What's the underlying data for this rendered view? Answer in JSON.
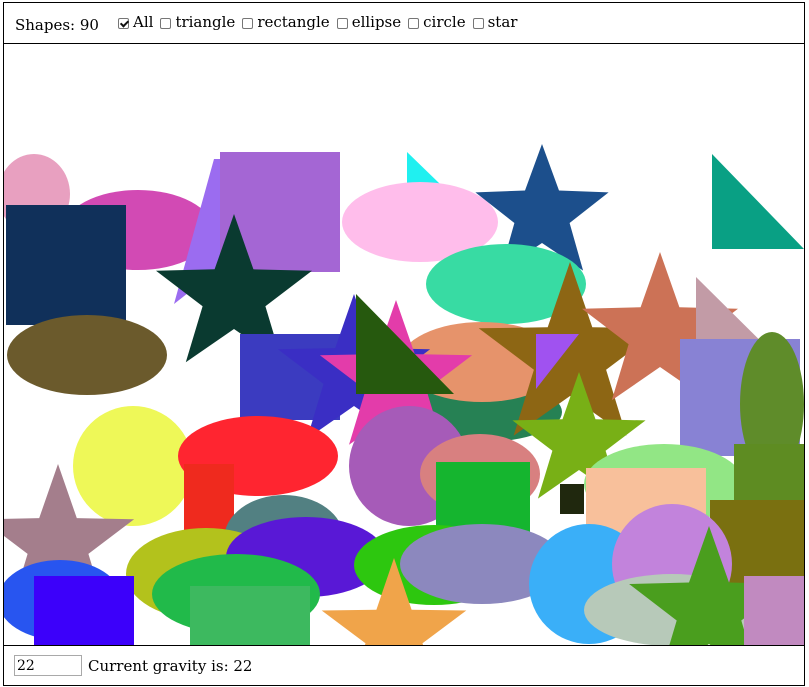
{
  "header": {
    "shape_count_label": "Shapes: 90",
    "filters": [
      {
        "label": "All",
        "checked": true
      },
      {
        "label": "triangle",
        "checked": false
      },
      {
        "label": "rectangle",
        "checked": false
      },
      {
        "label": "ellipse",
        "checked": false
      },
      {
        "label": "circle",
        "checked": false
      },
      {
        "label": "star",
        "checked": false
      }
    ]
  },
  "footer": {
    "gravity_value": "22",
    "gravity_label": "Current gravity is: 22"
  },
  "shapes": [
    {
      "type": "ellipse",
      "color": "#E8A0C0"
    },
    {
      "type": "ellipse",
      "color": "#D24AB4"
    },
    {
      "type": "triangle",
      "color": "#9B6CF0"
    },
    {
      "type": "rectangle",
      "color": "#A466D4"
    },
    {
      "type": "triangle",
      "color": "#20F0F0"
    },
    {
      "type": "ellipse",
      "color": "#FFBDEB"
    },
    {
      "type": "star",
      "color": "#1C4F8C"
    },
    {
      "type": "triangle",
      "color": "#09A084"
    },
    {
      "type": "rectangle",
      "color": "#10305A"
    },
    {
      "type": "star",
      "color": "#0A3A30"
    },
    {
      "type": "ellipse",
      "color": "#6B5A2C"
    },
    {
      "type": "ellipse",
      "color": "#38DBA3"
    },
    {
      "type": "ellipse",
      "color": "#268154"
    },
    {
      "type": "ellipse",
      "color": "#E6936B"
    },
    {
      "type": "rectangle",
      "color": "#3B3BC0"
    },
    {
      "type": "star",
      "color": "#3A2EC4"
    },
    {
      "type": "star",
      "color": "#E33CAA"
    },
    {
      "type": "triangle",
      "color": "#26590E"
    },
    {
      "type": "star",
      "color": "#8D6614"
    },
    {
      "type": "star",
      "color": "#CC7256"
    },
    {
      "type": "triangle",
      "color": "#C29BA6"
    },
    {
      "type": "rectangle",
      "color": "#8882D4"
    },
    {
      "type": "ellipse",
      "color": "#5F8C2A"
    },
    {
      "type": "star",
      "color": "#78B016"
    },
    {
      "type": "triangle",
      "color": "#A052F0"
    },
    {
      "type": "circle",
      "color": "#EEF858"
    },
    {
      "type": "ellipse",
      "color": "#FF2530"
    },
    {
      "type": "circle",
      "color": "#A65BB8"
    },
    {
      "type": "ellipse",
      "color": "#D88080"
    },
    {
      "type": "rectangle",
      "color": "#15B52F"
    },
    {
      "type": "ellipse",
      "color": "#92E685"
    },
    {
      "type": "rectangle",
      "color": "#F8C09B"
    },
    {
      "type": "rectangle",
      "color": "#5E8C22"
    },
    {
      "type": "rectangle",
      "color": "#7A7010"
    },
    {
      "type": "star",
      "color": "#A47E8C"
    },
    {
      "type": "rectangle",
      "color": "#EF2A1E"
    },
    {
      "type": "ellipse",
      "color": "#528082"
    },
    {
      "type": "ellipse",
      "color": "#B3C21C"
    },
    {
      "type": "ellipse",
      "color": "#5918D6"
    },
    {
      "type": "ellipse",
      "color": "#2DC70F"
    },
    {
      "type": "ellipse",
      "color": "#8C88BE"
    },
    {
      "type": "circle",
      "color": "#3AAFF8"
    },
    {
      "type": "circle",
      "color": "#C283DC"
    },
    {
      "type": "ellipse",
      "color": "#2855F0"
    },
    {
      "type": "rectangle",
      "color": "#3C00FA"
    },
    {
      "type": "ellipse",
      "color": "#21BA4A"
    },
    {
      "type": "rectangle",
      "color": "#3DB95F"
    },
    {
      "type": "star",
      "color": "#F0A44A"
    },
    {
      "type": "ellipse",
      "color": "#B7C9B9"
    },
    {
      "type": "star",
      "color": "#4A9E1E"
    },
    {
      "type": "rectangle",
      "color": "#C18AC0"
    },
    {
      "type": "rectangle",
      "color": "#20280E"
    }
  ]
}
